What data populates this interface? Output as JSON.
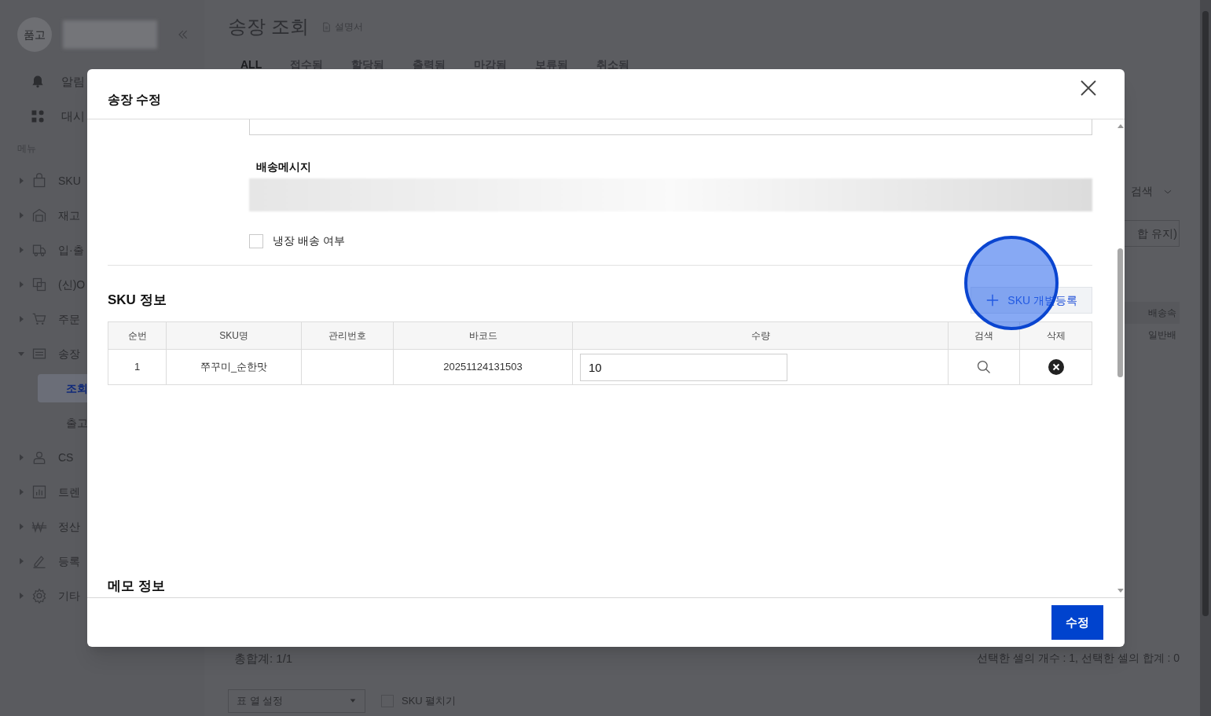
{
  "sidebar": {
    "logo_text": "품고",
    "section_label": "메뉴",
    "top_items": [
      {
        "label": "알림"
      },
      {
        "label": "대시"
      }
    ],
    "items": [
      {
        "label": "SKU",
        "expanded": false
      },
      {
        "label": "재고",
        "expanded": false
      },
      {
        "label": "입·출",
        "expanded": false
      },
      {
        "label": "(신)O",
        "expanded": false
      },
      {
        "label": "주문",
        "expanded": false
      },
      {
        "label": "송장",
        "expanded": true,
        "children": [
          {
            "label": "조회",
            "selected": true
          },
          {
            "label": "출고",
            "selected": false
          }
        ]
      },
      {
        "label": "CS",
        "expanded": false
      },
      {
        "label": "트렌",
        "expanded": false
      },
      {
        "label": "정산",
        "expanded": false
      },
      {
        "label": "등록",
        "expanded": false
      },
      {
        "label": "기타",
        "expanded": false
      }
    ]
  },
  "page": {
    "title": "송장 조회",
    "manual_link": "설명서",
    "tabs": [
      {
        "label": "ALL",
        "selected": true
      },
      {
        "label": "접수됨",
        "selected": false
      },
      {
        "label": "할당됨",
        "selected": false
      },
      {
        "label": "출력됨",
        "selected": false
      },
      {
        "label": "마감됨",
        "selected": false
      },
      {
        "label": "보류됨",
        "selected": false
      },
      {
        "label": "취소됨",
        "selected": false
      }
    ],
    "search_dropdown": "검색",
    "keep_button": "합 유지)",
    "column_headers": [
      "배송속"
    ],
    "cells": [
      "일반배"
    ],
    "total": "총합계: 1/1",
    "column_settings": "표 열 설정",
    "sku_expand": {
      "label": "SKU 펼치기",
      "checked": false
    },
    "selection_summary": "선택한 셀의 개수 : 1, 선택한 셀의 합계 : 0"
  },
  "modal": {
    "title": "송장 수정",
    "delivery_message_label": "배송메시지",
    "cold_shipping": {
      "label": "냉장 배송 여부",
      "checked": false
    },
    "sku_section": {
      "title": "SKU 정보",
      "add_button": "SKU 개별등록",
      "columns": [
        "순번",
        "SKU명",
        "관리번호",
        "바코드",
        "수량",
        "검색",
        "삭제"
      ],
      "rows": [
        {
          "index": "1",
          "sku_name": "쭈꾸미_순한맛",
          "barcode": "20251124131503",
          "quantity": "10"
        }
      ]
    },
    "memo_section": {
      "title": "메모 정보"
    },
    "submit_button": "수정"
  }
}
